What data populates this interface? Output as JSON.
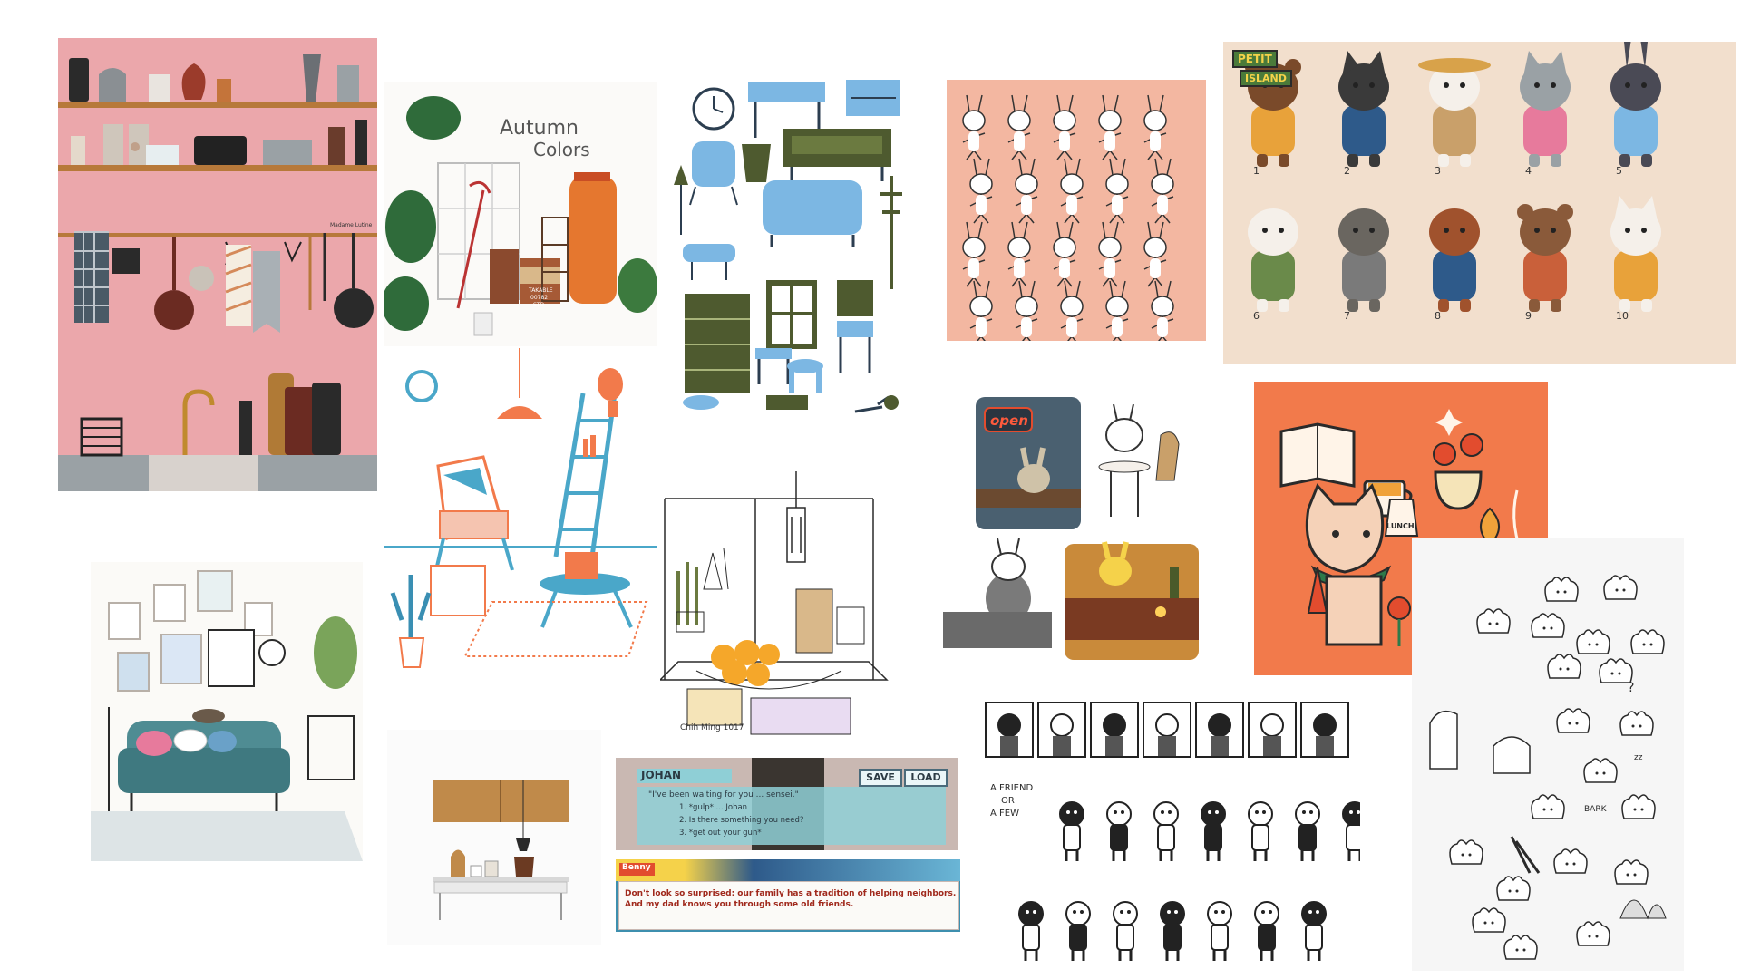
{
  "colors": {
    "kitchen_pink": "#eba7ab",
    "shelf_brown": "#b7793a",
    "salmon": "#f3b7a1",
    "bear_beige": "#f2dfcd",
    "orange": "#f27a4b",
    "teal_sofa": "#4f8c93",
    "furniture_blue": "#7cb7e3",
    "furniture_green": "#4e5a2f",
    "vn_teal": "#8fcfd6",
    "vn_dark": "#2b3a43"
  },
  "tiles": {
    "kitchen": {
      "signature": "Madame Lutine"
    },
    "autumn": {
      "title_line1": "Autumn",
      "title_line2": "Colors",
      "label1": "TAKABLE",
      "label2": "00782",
      "label3": "STD"
    },
    "furniture": {},
    "bunnies": {},
    "island": {
      "logo_line1": "PETIT",
      "logo_line2": "ISLAND",
      "numbers": [
        "1",
        "2",
        "3",
        "4",
        "5",
        "6",
        "7",
        "8",
        "9",
        "10"
      ]
    },
    "cafe": {
      "sign": "open"
    },
    "cat_sticker": {
      "bag_label": "LUNCH"
    },
    "living": {},
    "sketch": {
      "signature": "Chih Ming 1017"
    },
    "cabinet": {},
    "vn_top": {
      "name": "JOHAN",
      "save": "SAVE",
      "load": "LOAD",
      "quote": "\"I've been waiting for you ... sensei.\"",
      "choices": [
        "1. *gulp* ... Johan",
        "2. Is there something you need?",
        "3. *get out your gun*"
      ]
    },
    "vn_bottom": {
      "name": "Benny",
      "line1": "Don't look so surprised: our family has a tradition of helping neighbors.",
      "line2": "And my dad knows you through some old friends."
    },
    "comic": {
      "caption_line1": "A FRIEND",
      "caption_line2": "OR",
      "caption_line3": "A FEW"
    },
    "doodles": {
      "bark": "BARK",
      "zz": "zz",
      "q": "?"
    }
  }
}
